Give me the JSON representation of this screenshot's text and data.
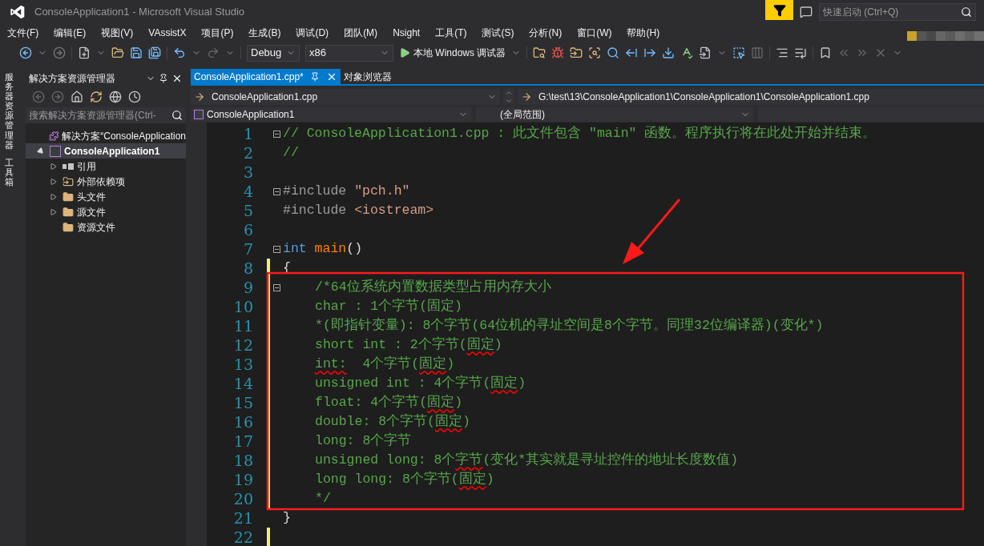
{
  "window": {
    "title": "ConsoleApplication1 - Microsoft Visual Studio"
  },
  "quick_launch": {
    "placeholder": "快速启动 (Ctrl+Q)"
  },
  "menu": [
    "文件(F)",
    "编辑(E)",
    "视图(V)",
    "VAssistX",
    "项目(P)",
    "生成(B)",
    "调试(D)",
    "团队(M)",
    "Nsight",
    "工具(T)",
    "测试(S)",
    "分析(N)",
    "窗口(W)",
    "帮助(H)"
  ],
  "toolbar": {
    "configuration": "Debug",
    "platform": "x86",
    "run_label": "本地 Windows 调试器"
  },
  "side_tabs": [
    "服务器资源管理器",
    "工具箱"
  ],
  "solution_explorer": {
    "title": "解决方案资源管理器",
    "search_placeholder": "搜索解决方案资源管理器(Ctrl-",
    "tree": [
      {
        "label": "解决方案“ConsoleApplication",
        "kind": "solution",
        "selected": false,
        "children": [
          {
            "label": "ConsoleApplication1",
            "kind": "project",
            "selected": true,
            "expandable": true,
            "expanded": true,
            "children": [
              {
                "label": "引用",
                "kind": "reference",
                "selected": false,
                "expandable": true,
                "expanded": false
              },
              {
                "label": "外部依赖项",
                "kind": "external",
                "selected": false,
                "expandable": true,
                "expanded": false
              },
              {
                "label": "头文件",
                "kind": "folder",
                "selected": false,
                "expandable": true,
                "expanded": false
              },
              {
                "label": "源文件",
                "kind": "folder",
                "selected": false,
                "expandable": true,
                "expanded": false
              },
              {
                "label": "资源文件",
                "kind": "folder",
                "selected": false,
                "expandable": false
              }
            ]
          }
        ]
      }
    ]
  },
  "tabs": [
    {
      "label": "ConsoleApplication1.cpp*",
      "selected": true,
      "pinned": true
    },
    {
      "label": "对象浏览器",
      "selected": false,
      "pinned": false
    }
  ],
  "navigation": {
    "file": "ConsoleApplication1.cpp",
    "path": "G:\\test\\13\\ConsoleApplication1\\ConsoleApplication1\\ConsoleApplication1.cpp",
    "project": "ConsoleApplication1",
    "scope": "(全局范围)"
  },
  "code_lines": [
    {
      "number": "1",
      "fold": true,
      "changed": false,
      "segments": [
        {
          "text": "// ConsoleApplication1.cpp : 此文件包含 \"main\" 函数。程序执行将在此处开始并结束。",
          "kind": "comment"
        }
      ]
    },
    {
      "number": "2",
      "fold": false,
      "changed": false,
      "segments": [
        {
          "text": "//",
          "kind": "comment"
        }
      ]
    },
    {
      "number": "3",
      "fold": false,
      "changed": false
    },
    {
      "number": "4",
      "fold": true,
      "changed": false,
      "segments": [
        {
          "text": "#include ",
          "kind": "preproc"
        },
        {
          "text": "\"pch.h\"",
          "kind": "string"
        }
      ]
    },
    {
      "number": "5",
      "fold": false,
      "changed": false,
      "segments": [
        {
          "text": "#include ",
          "kind": "preproc"
        },
        {
          "text": "<iostream>",
          "kind": "string"
        }
      ]
    },
    {
      "number": "6",
      "fold": false,
      "changed": false
    },
    {
      "number": "7",
      "fold": true,
      "changed": false,
      "segments": [
        {
          "text": "int",
          "kind": "keyword"
        },
        {
          "text": " main",
          "kind": "function"
        },
        {
          "text": "()",
          "kind": "plain"
        }
      ]
    },
    {
      "number": "8",
      "fold": false,
      "changed": true,
      "segments": [
        {
          "text": "{",
          "kind": "plain"
        }
      ],
      "children": [
        {
          "number": "9",
          "fold": true,
          "changed": true,
          "segments": [
            {
              "text": "/*64位系统内置数据类型占用内存大小",
              "kind": "comment"
            }
          ]
        },
        {
          "number": "10",
          "fold": false,
          "changed": true,
          "segments": [
            {
              "text": "char : 1个字节(固定)",
              "kind": "comment"
            }
          ]
        },
        {
          "number": "11",
          "fold": false,
          "changed": true,
          "segments": [
            {
              "text": "*(即指针变量): 8个字节(64位机的寻址空间是8个字节。同理32位编译器)(变化*)",
              "kind": "comment"
            }
          ]
        },
        {
          "number": "12",
          "fold": false,
          "changed": true,
          "segments": [
            {
              "text": "short int : 2个字节(",
              "kind": "comment"
            },
            {
              "text": "固定",
              "kind": "squiggle"
            },
            {
              "text": ")",
              "kind": "comment"
            }
          ]
        },
        {
          "number": "13",
          "fold": false,
          "changed": true,
          "segments": [
            {
              "text": "int:",
              "kind": "squiggle"
            },
            {
              "text": "  4个字节(",
              "kind": "comment"
            },
            {
              "text": "固定",
              "kind": "squiggle"
            },
            {
              "text": ")",
              "kind": "comment"
            }
          ]
        },
        {
          "number": "14",
          "fold": false,
          "changed": true,
          "segments": [
            {
              "text": "unsigned int : 4个字节(",
              "kind": "comment"
            },
            {
              "text": "固定",
              "kind": "squiggle"
            },
            {
              "text": ")",
              "kind": "comment"
            }
          ]
        },
        {
          "number": "15",
          "fold": false,
          "changed": true,
          "segments": [
            {
              "text": "float: 4个字节(",
              "kind": "comment"
            },
            {
              "text": "固定",
              "kind": "squiggle"
            },
            {
              "text": ")",
              "kind": "comment"
            }
          ]
        },
        {
          "number": "16",
          "fold": false,
          "changed": true,
          "segments": [
            {
              "text": "double: 8个字节(",
              "kind": "comment"
            },
            {
              "text": "固定",
              "kind": "squiggle"
            },
            {
              "text": ")",
              "kind": "comment"
            }
          ]
        },
        {
          "number": "17",
          "fold": false,
          "changed": true,
          "segments": [
            {
              "text": "long: 8个字节",
              "kind": "comment"
            }
          ]
        },
        {
          "number": "18",
          "fold": false,
          "changed": true,
          "segments": [
            {
              "text": "unsigned long: 8个",
              "kind": "comment"
            },
            {
              "text": "字节",
              "kind": "squiggle"
            },
            {
              "text": "(变化*其实就是寻址控件的地址长度数值)",
              "kind": "comment"
            }
          ]
        },
        {
          "number": "19",
          "fold": false,
          "changed": true,
          "segments": [
            {
              "text": "long long: 8个字节(",
              "kind": "comment"
            },
            {
              "text": "固定",
              "kind": "squiggle"
            },
            {
              "text": ")",
              "kind": "comment"
            }
          ]
        },
        {
          "number": "20",
          "fold": false,
          "changed": true,
          "segments": [
            {
              "text": "*/",
              "kind": "comment"
            }
          ]
        }
      ]
    },
    {
      "number": "21",
      "fold": false,
      "changed": false,
      "segments": [
        {
          "text": "}",
          "kind": "plain"
        }
      ]
    },
    {
      "number": "22",
      "fold": false,
      "changed": true
    }
  ]
}
